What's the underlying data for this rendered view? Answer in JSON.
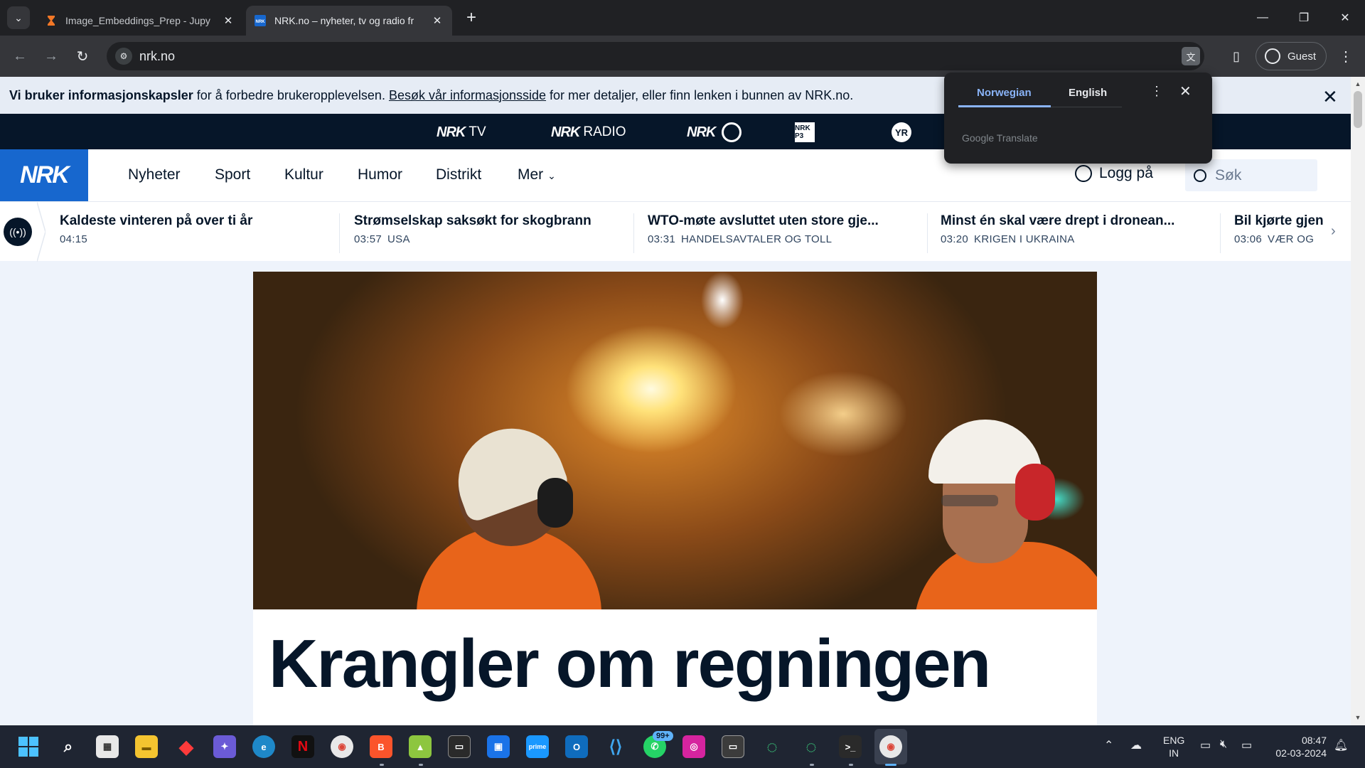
{
  "browser": {
    "tabs": [
      {
        "title": "Image_Embeddings_Prep - Jupy",
        "active": false
      },
      {
        "title": "NRK.no – nyheter, tv og radio fr",
        "active": true
      }
    ],
    "new_tab": "+",
    "url": "nrk.no",
    "profile": "Guest",
    "window_controls": {
      "minimize": "—",
      "restore": "❐",
      "close": "✕"
    }
  },
  "cookie_banner": {
    "bold": "Vi bruker informasjonskapsler",
    "text1": " for å forbedre brukeropplevelsen. ",
    "link": "Besøk vår informasjonsside",
    "text2": " for mer detaljer, eller finn lenken i bunnen av NRK.no."
  },
  "services": {
    "tv": {
      "brand": "NRK",
      "label": "TV"
    },
    "radio": {
      "brand": "NRK",
      "label": "RADIO"
    },
    "super": {
      "brand": "NRK"
    },
    "p3": {
      "label": "NRK P3"
    },
    "yr": {
      "label": "YR"
    }
  },
  "nav": {
    "logo": "NRK",
    "links": [
      "Nyheter",
      "Sport",
      "Kultur",
      "Humor",
      "Distrikt",
      "Mer"
    ],
    "login": "Logg på",
    "search_placeholder": "Søk"
  },
  "ticker": [
    {
      "headline": "Kaldeste vinteren på over ti år",
      "time": "04:15",
      "tag": ""
    },
    {
      "headline": "Strømselskap saksøkt for skogbrann",
      "time": "03:57",
      "tag": "USA"
    },
    {
      "headline": "WTO-møte avsluttet uten store gje...",
      "time": "03:31",
      "tag": "HANDELSAVTALER OG TOLL"
    },
    {
      "headline": "Minst én skal være drept i dronean...",
      "time": "03:20",
      "tag": "KRIGEN I UKRAINA"
    },
    {
      "headline": "Bil kjørte gjen",
      "time": "03:06",
      "tag": "VÆR OG"
    }
  ],
  "article": {
    "headline": "Krangler om regningen"
  },
  "translate_popup": {
    "source": "Norwegian",
    "target": "English",
    "footer": "Google Translate"
  },
  "taskbar": {
    "lang_top": "ENG",
    "lang_bottom": "IN",
    "time": "08:47",
    "date": "02-03-2024",
    "whatsapp_badge": "99+"
  },
  "colors": {
    "nrk_navy": "#061629",
    "nrk_blue": "#1767ce",
    "page_bg": "#eef3fb",
    "chrome_dark": "#202124",
    "translate_accent": "#8ab4f8"
  }
}
